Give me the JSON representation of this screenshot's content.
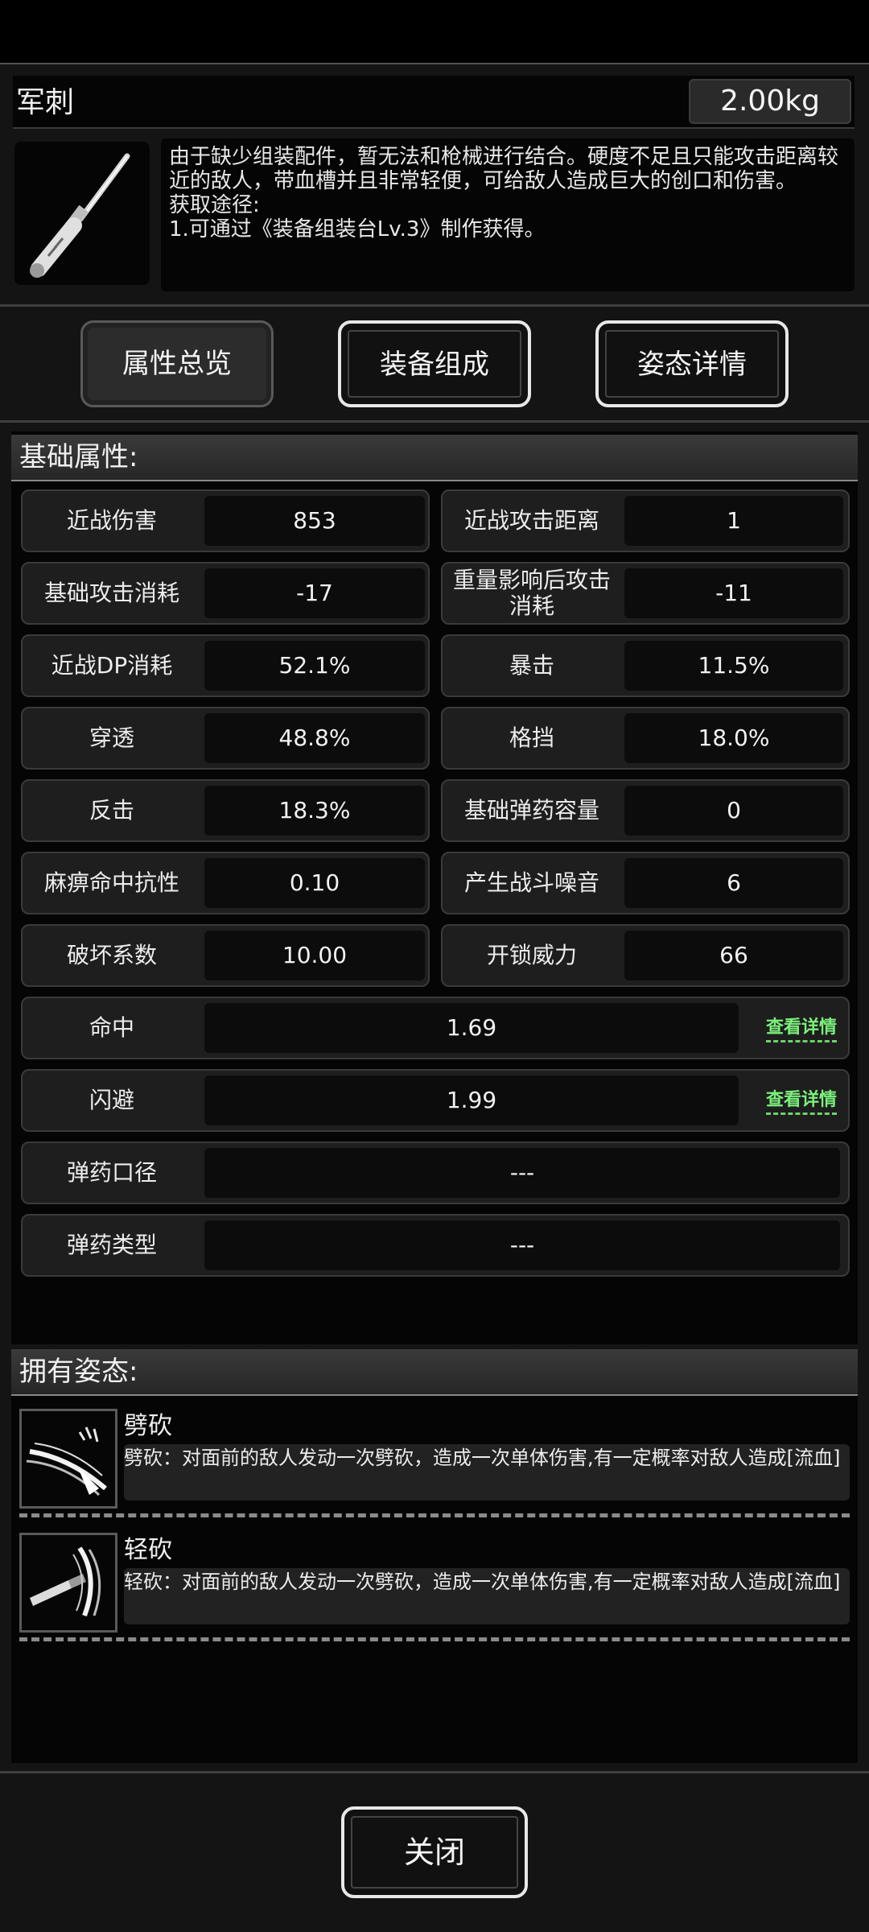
{
  "item": {
    "name": "军刺",
    "weight": "2.00kg",
    "description": "由于缺少组装配件，暂无法和枪械进行结合。硬度不足且只能攻击距离较近的敌人，带血槽并且非常轻便，可给敌人造成巨大的创口和伤害。\n获取途径:\n1.可通过《装备组装台Lv.3》制作获得。"
  },
  "tabs": [
    {
      "label": "属性总览"
    },
    {
      "label": "装备组成"
    },
    {
      "label": "姿态详情"
    }
  ],
  "base_stats": {
    "header": "基础属性:",
    "pairs": [
      {
        "left_label": "近战伤害",
        "left_value": "853",
        "right_label": "近战攻击距离",
        "right_value": "1"
      },
      {
        "left_label": "基础攻击消耗",
        "left_value": "-17",
        "right_label": "重量影响后攻击消耗",
        "right_value": "-11"
      },
      {
        "left_label": "近战DP消耗",
        "left_value": "52.1%",
        "right_label": "暴击",
        "right_value": "11.5%"
      },
      {
        "left_label": "穿透",
        "left_value": "48.8%",
        "right_label": "格挡",
        "right_value": "18.0%"
      },
      {
        "left_label": "反击",
        "left_value": "18.3%",
        "right_label": "基础弹药容量",
        "right_value": "0"
      },
      {
        "left_label": "麻痹命中抗性",
        "left_value": "0.10",
        "right_label": "产生战斗噪音",
        "right_value": "6"
      },
      {
        "left_label": "破坏系数",
        "left_value": "10.00",
        "right_label": "开锁威力",
        "right_value": "66"
      }
    ],
    "wide": [
      {
        "label": "命中",
        "value": "1.69",
        "link": "查看详情"
      },
      {
        "label": "闪避",
        "value": "1.99",
        "link": "查看详情"
      },
      {
        "label": "弹药口径",
        "value": "---"
      },
      {
        "label": "弹药类型",
        "value": "---"
      }
    ]
  },
  "stances": {
    "header": "拥有姿态:",
    "items": [
      {
        "name": "劈砍",
        "description": "劈砍：对面前的敌人发动一次劈砍，造成一次单体伤害,有一定概率对敌人造成[流血]",
        "icon": "slash-icon"
      },
      {
        "name": "轻砍",
        "description": "轻砍：对面前的敌人发动一次劈砍，造成一次单体伤害,有一定概率对敌人造成[流血]",
        "icon": "light-slash-icon"
      }
    ]
  },
  "footer": {
    "close_label": "关闭"
  }
}
